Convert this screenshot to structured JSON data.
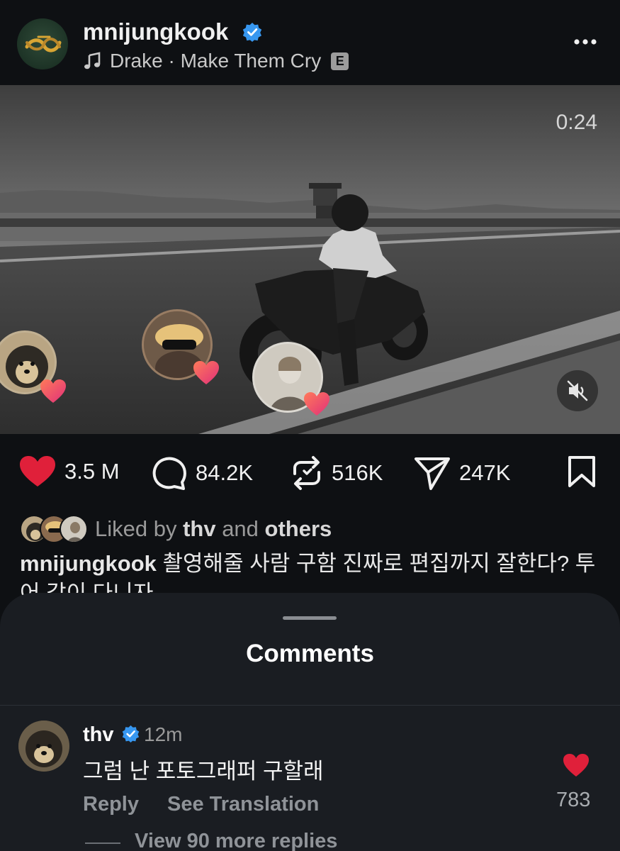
{
  "post": {
    "username": "mnijungkook",
    "music_label": "Drake · Make Them Cry",
    "explicit_badge": "E",
    "video_time": "0:24"
  },
  "actions": {
    "likes": "3.5 M",
    "comments": "84.2K",
    "reposts": "516K",
    "shares": "247K"
  },
  "liked_by": {
    "prefix": "Liked by ",
    "user": "thv",
    "middle": " and ",
    "others": "others"
  },
  "caption": {
    "user": "mnijungkook",
    "text": "촬영해줄 사람 구함 진짜로 편집까지 잘한다? 투어 같이 다니자"
  },
  "comments_sheet": {
    "title": "Comments",
    "comment": {
      "user": "thv",
      "time": "12m",
      "text": "그럼 난 포토그래퍼 구할래",
      "reply_label": "Reply",
      "translate_label": "See Translation",
      "likes": "783",
      "view_more": "View 90 more replies"
    }
  },
  "colors": {
    "background": "#0e1013",
    "sheet": "#1a1d22",
    "heart": "#e0203a",
    "verified": "#3797f0"
  }
}
